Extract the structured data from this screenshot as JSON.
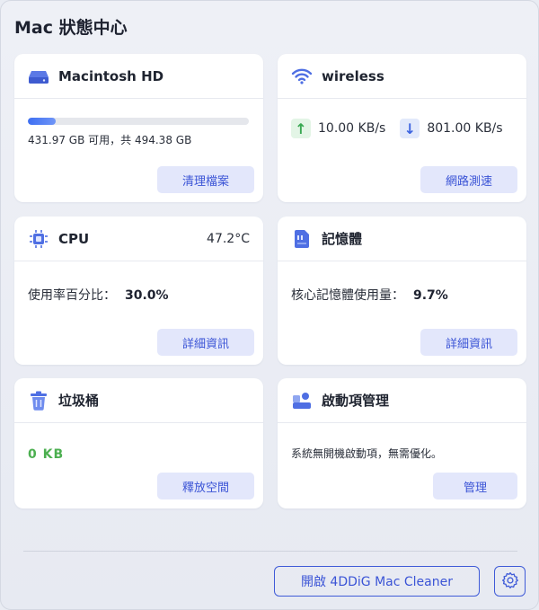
{
  "app": {
    "title": "Mac 狀態中心"
  },
  "disk": {
    "name": "Macintosh HD",
    "used_fraction": 0.126,
    "info": "431.97 GB 可用，共 494.38 GB",
    "action": "清理檔案"
  },
  "network": {
    "name": "wireless",
    "upload": "10.00 KB/s",
    "download": "801.00 KB/s",
    "action": "網路測速"
  },
  "cpu": {
    "name": "CPU",
    "temperature": "47.2°C",
    "usage_label": "使用率百分比：",
    "usage_value": "30.0%",
    "action": "詳細資訊"
  },
  "memory": {
    "name": "記憶體",
    "usage_label": "核心記憶體使用量：",
    "usage_value": "9.7%",
    "action": "詳細資訊"
  },
  "trash": {
    "name": "垃圾桶",
    "size": "0  KB",
    "action": "釋放空間"
  },
  "startup": {
    "name": "啟動項管理",
    "message": "系統無開機啟動項，無需優化。",
    "action": "管理"
  },
  "footer": {
    "open_label": "開啟 4DDiG Mac Cleaner"
  },
  "colors": {
    "accent": "#3b54d6",
    "success": "#4caf50",
    "button_bg": "#e3e7fb"
  }
}
